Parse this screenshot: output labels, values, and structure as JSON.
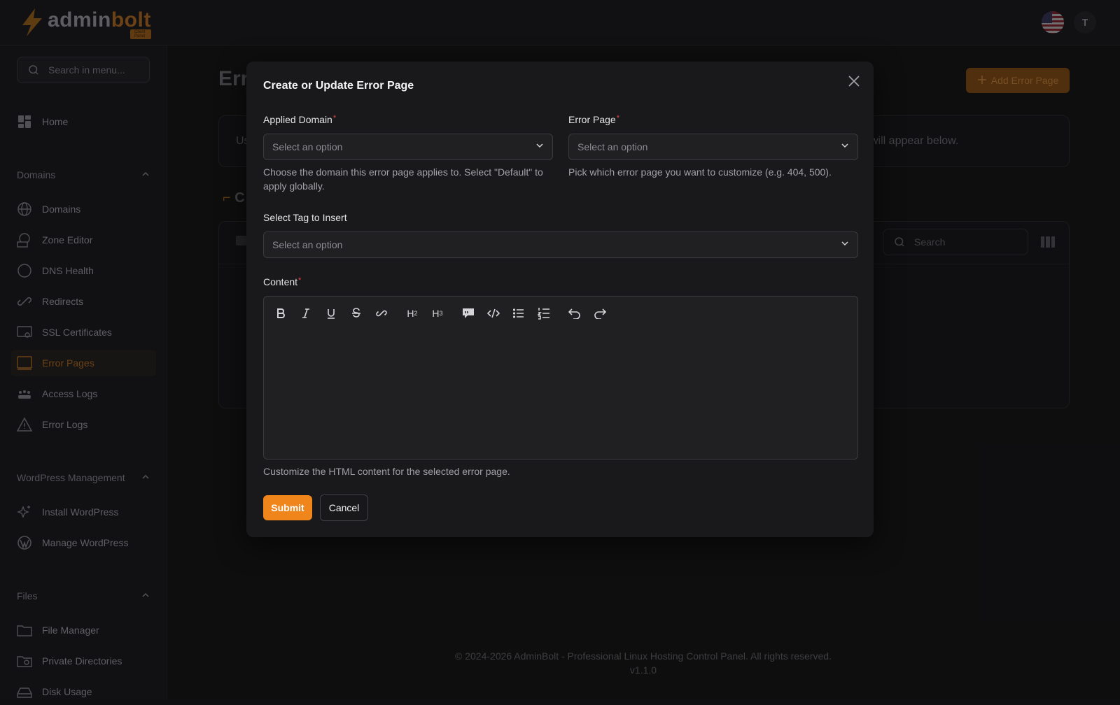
{
  "brand": {
    "name_a": "admin",
    "name_b": "bolt",
    "badge": "Client Panel"
  },
  "user": {
    "initial": "T"
  },
  "sidebar": {
    "search_placeholder": "Search in menu...",
    "home": "Home",
    "groups": [
      {
        "title": "Domains",
        "items": [
          "Domains",
          "Zone Editor",
          "DNS Health",
          "Redirects",
          "SSL Certificates",
          "Error Pages",
          "Access Logs",
          "Error Logs"
        ]
      },
      {
        "title": "WordPress Management",
        "items": [
          "Install WordPress",
          "Manage WordPress"
        ]
      },
      {
        "title": "Files",
        "items": [
          "File Manager",
          "Private Directories",
          "Disk Usage"
        ]
      }
    ],
    "active_item": "Error Pages"
  },
  "main": {
    "title_partial": "Err",
    "add_button": "Add Error Page",
    "info_left": "Us",
    "info_right": "will appear below.",
    "section_partial": "C",
    "table_search_placeholder": "Search"
  },
  "footer": {
    "copyright": "© 2024-2026 AdminBolt - Professional Linux Hosting Control Panel. All rights reserved.",
    "version": "v1.1.0"
  },
  "modal": {
    "title": "Create or Update Error Page",
    "applied_domain": {
      "label": "Applied Domain",
      "placeholder": "Select an option",
      "hint": "Choose the domain this error page applies to. Select \"Default\" to apply globally."
    },
    "error_page": {
      "label": "Error Page",
      "placeholder": "Select an option",
      "hint": "Pick which error page you want to customize (e.g. 404, 500)."
    },
    "tag": {
      "label": "Select Tag to Insert",
      "placeholder": "Select an option"
    },
    "content": {
      "label": "Content",
      "hint": "Customize the HTML content for the selected error page.",
      "toolbar": [
        "bold-icon",
        "italic-icon",
        "underline-icon",
        "strikethrough-icon",
        "link-icon",
        "heading2-icon",
        "heading3-icon",
        "blockquote-icon",
        "code-block-icon",
        "bullet-list-icon",
        "ordered-list-icon",
        "undo-icon",
        "redo-icon"
      ]
    },
    "submit": "Submit",
    "cancel": "Cancel"
  },
  "colors": {
    "accent": "#f0851c",
    "required": "#ef4444",
    "modal_bg": "#19191b"
  }
}
